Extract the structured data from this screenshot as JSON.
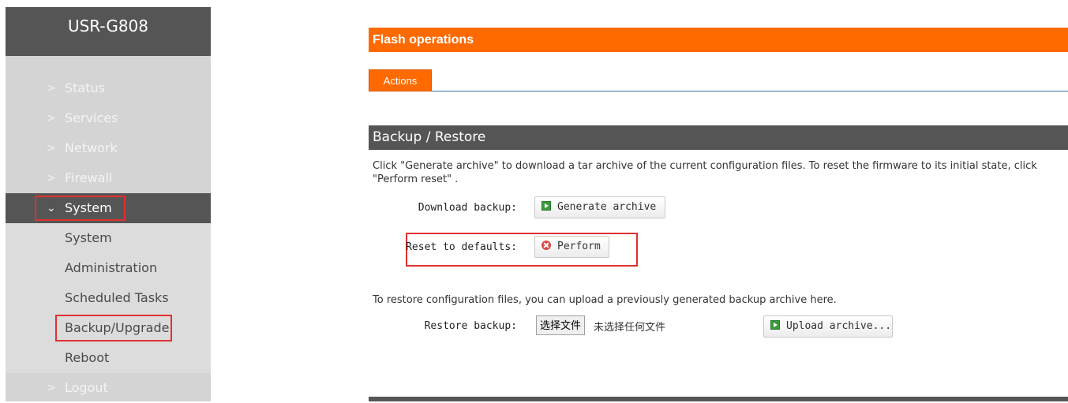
{
  "sidebar": {
    "brand": "USR-G808",
    "top_items": [
      {
        "label": "Status"
      },
      {
        "label": "Services"
      },
      {
        "label": "Network"
      },
      {
        "label": "Firewall"
      }
    ],
    "active_item": {
      "label": "System"
    },
    "sub_items": [
      {
        "label": "System"
      },
      {
        "label": "Administration"
      },
      {
        "label": "Scheduled Tasks"
      },
      {
        "label": "Backup/Upgrade"
      },
      {
        "label": "Reboot"
      }
    ],
    "bottom_item": {
      "label": "Logout"
    }
  },
  "main": {
    "page_title": "Flash operations",
    "tab_label": "Actions",
    "section_title": "Backup / Restore",
    "section_desc": "Click \"Generate archive\" to download a tar archive of the current configuration files. To reset the firmware to its initial state, click \"Perform reset\" .",
    "download_label": "Download backup:",
    "generate_button": "Generate archive",
    "reset_label": "Reset to defaults:",
    "perform_button": "Perform",
    "restore_desc": "To restore configuration files, you can upload a previously generated backup archive here.",
    "restore_label": "Restore backup:",
    "choose_file_button": "选择文件",
    "no_file_text": "未选择任何文件",
    "upload_button": "Upload archive..."
  },
  "colors": {
    "accent_orange": "#ff6a00",
    "dark_bar": "#555555",
    "highlight_red": "#e03030"
  }
}
